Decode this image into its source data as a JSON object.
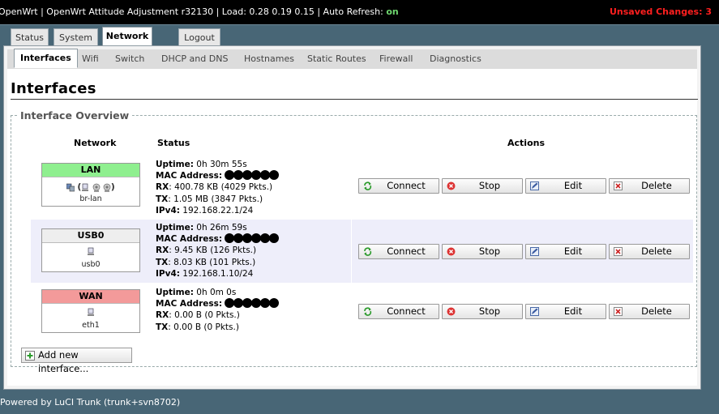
{
  "topbar": {
    "title": "OpenWrt | OpenWrt Attitude Adjustment r32130 | Load: 0.28 0.19 0.15 | Auto Refresh: ",
    "auto_refresh_state": "on",
    "unsaved": "Unsaved Changes: 3"
  },
  "main_tabs": [
    {
      "label": "Status",
      "active": false
    },
    {
      "label": "System",
      "active": false
    },
    {
      "label": "Network",
      "active": true
    },
    {
      "label": "Logout",
      "active": false
    }
  ],
  "sub_tabs": [
    {
      "label": "Interfaces",
      "active": true
    },
    {
      "label": "Wifi"
    },
    {
      "label": "Switch"
    },
    {
      "label": "DHCP and DNS"
    },
    {
      "label": "Hostnames"
    },
    {
      "label": "Static Routes"
    },
    {
      "label": "Firewall"
    },
    {
      "label": "Diagnostics"
    }
  ],
  "page_title": "Interfaces",
  "section_title": "Interface Overview",
  "table_headers": {
    "network": "Network",
    "status": "Status",
    "actions": "Actions"
  },
  "labels": {
    "uptime": "Uptime:",
    "mac": "MAC Address:",
    "rx": "RX",
    "tx": "TX",
    "ipv4": "IPv4:"
  },
  "interfaces": [
    {
      "name": "LAN",
      "header_color": "#8fef8f",
      "icons": "bridge-icon ( ethernet-icon wifi-icon wifi-icon )",
      "device": "br-lan",
      "uptime": "0h 30m 55s",
      "rx": ": 400.78 KB (4029 Pkts.)",
      "tx": ": 1.05 MB (3847 Pkts.)",
      "ipv4": "192.168.22.1/24"
    },
    {
      "name": "USB0",
      "header_color": "#eeeeee",
      "icons": "ethernet-icon",
      "device": "usb0",
      "uptime": "0h 26m 59s",
      "rx": ": 9.45 KB (126 Pkts.)",
      "tx": ": 8.03 KB (101 Pkts.)",
      "ipv4": "192.168.1.10/24"
    },
    {
      "name": "WAN",
      "header_color": "#f39a9a",
      "icons": "ethernet-icon",
      "device": "eth1",
      "uptime": "0h 0m 0s",
      "rx": ": 0.00 B (0 Pkts.)",
      "tx": ": 0.00 B (0 Pkts.)"
    }
  ],
  "actions": {
    "connect": "Connect",
    "stop": "Stop",
    "edit": "Edit",
    "delete": "Delete"
  },
  "add_button": "Add new interface...",
  "footer": "Powered by LuCI Trunk (trunk+svn8702)"
}
